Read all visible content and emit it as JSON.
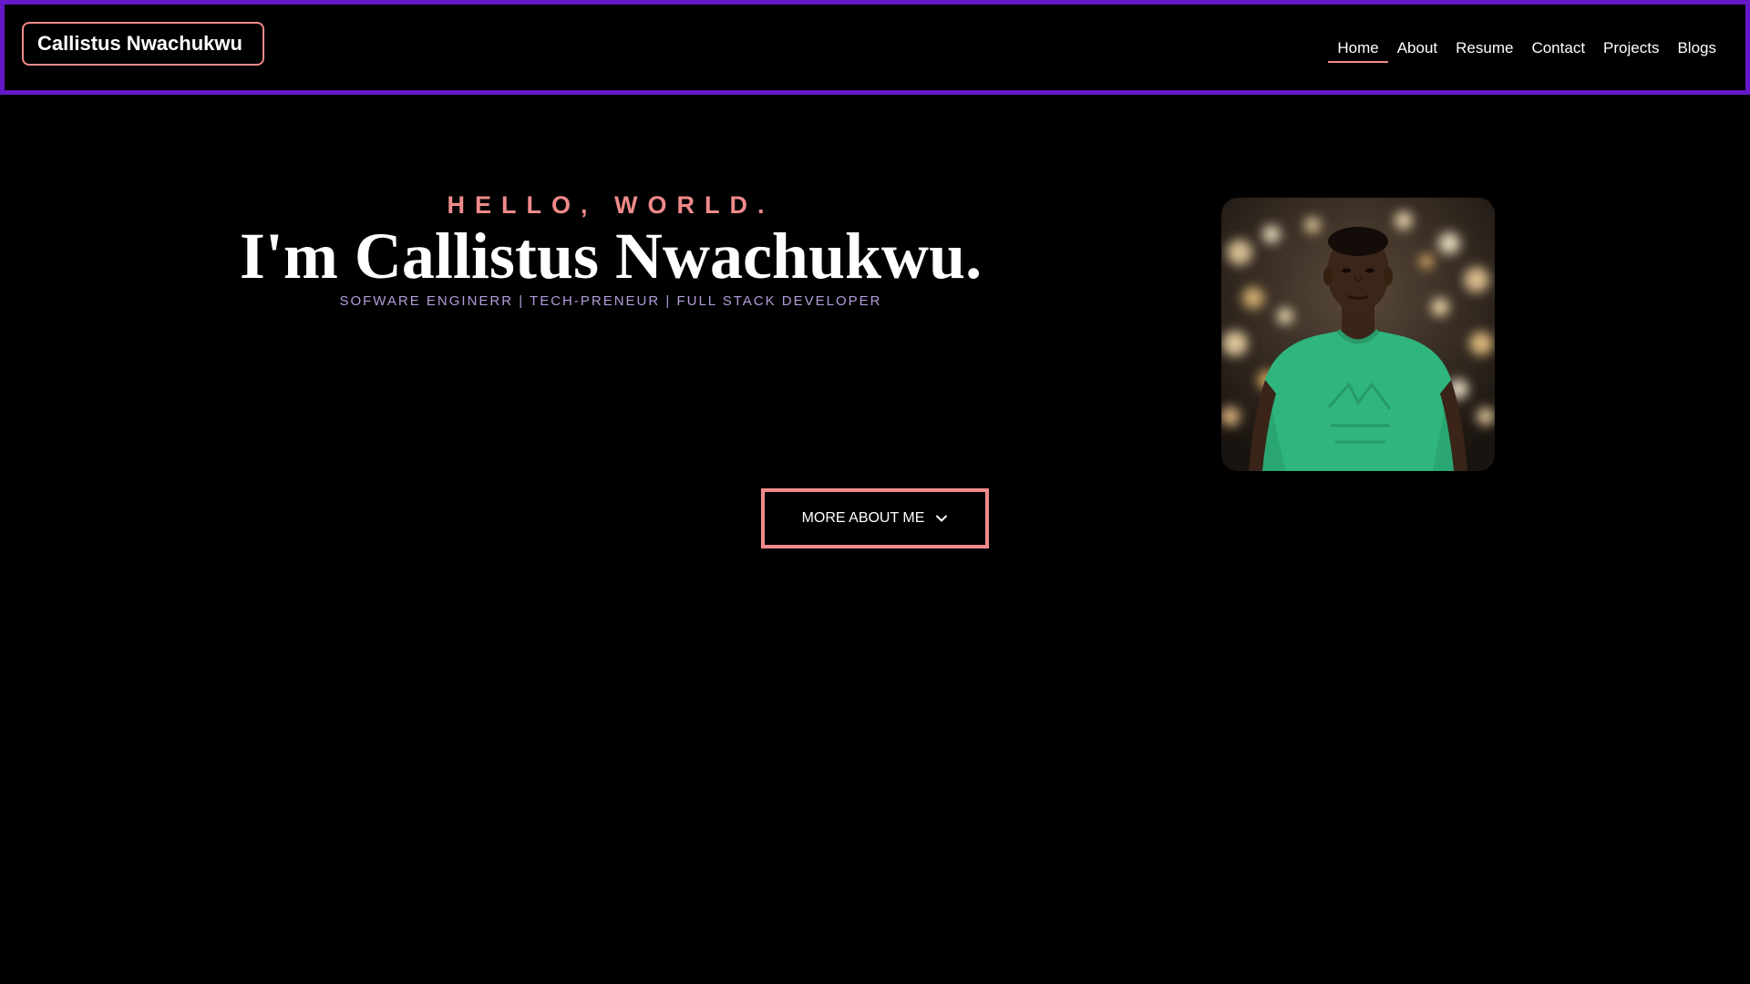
{
  "header": {
    "brand": "Callistus Nwachukwu",
    "nav": [
      {
        "label": "Home",
        "active": true
      },
      {
        "label": "About"
      },
      {
        "label": "Resume"
      },
      {
        "label": "Contact"
      },
      {
        "label": "Projects"
      },
      {
        "label": "Blogs"
      }
    ]
  },
  "hero": {
    "greeting": "HELLO, WORLD.",
    "headline": "I'm Callistus Nwachukwu.",
    "subtitle": "SOFWARE ENGINERR | TECH-PRENEUR | FULL STACK DEVELOPER",
    "photo_icon": "profile-photo",
    "cta_label": "MORE ABOUT ME",
    "cta_icon": "chevron-down-icon"
  },
  "colors": {
    "background": "#000000",
    "nav_border": "#6419c8",
    "accent": "#f08a8a",
    "subtitle": "#b39ddb",
    "text": "#ffffff"
  }
}
